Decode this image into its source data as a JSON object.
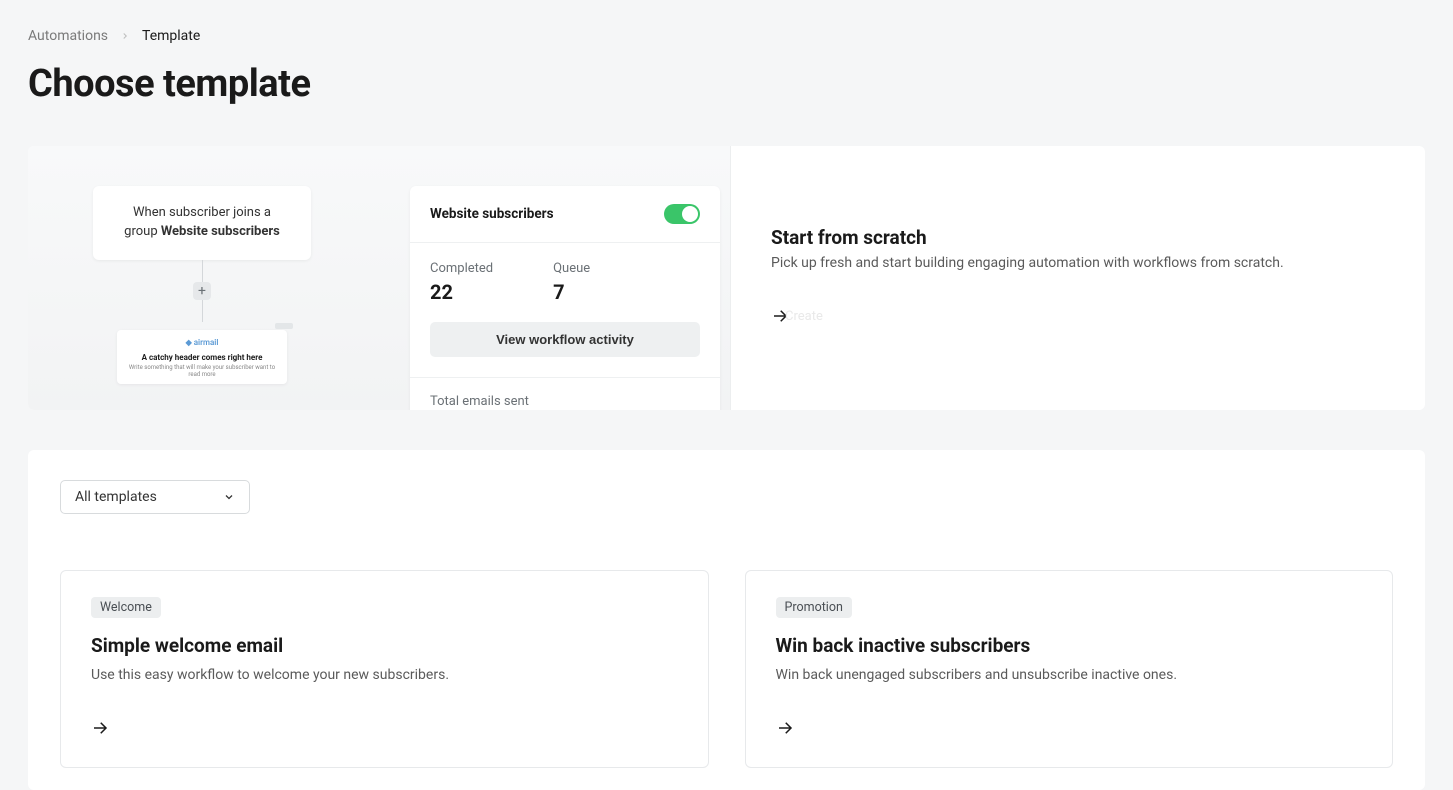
{
  "breadcrumb": {
    "root": "Automations",
    "current": "Template"
  },
  "page_title": "Choose template",
  "hero": {
    "illustration": {
      "node_prefix": "When subscriber joins a group ",
      "node_bold": "Website subscribers",
      "email_preview_brand": "◆ airmail",
      "email_preview_headline": "A catchy header comes right here",
      "email_preview_sub": "Write something that will make your subscriber want to read more"
    },
    "stats": {
      "title": "Website subscribers",
      "toggle_on": true,
      "completed_label": "Completed",
      "completed_value": "22",
      "queue_label": "Queue",
      "queue_value": "7",
      "view_button": "View workflow activity",
      "total_label": "Total emails sent"
    },
    "scratch": {
      "title": "Start from scratch",
      "description": "Pick up fresh and start building engaging automation with workflows from scratch.",
      "cta": "Create"
    }
  },
  "templates_section": {
    "filter_selected": "All templates",
    "cards": [
      {
        "tag": "Welcome",
        "title": "Simple welcome email",
        "description": "Use this easy workflow to welcome your new subscribers."
      },
      {
        "tag": "Promotion",
        "title": "Win back inactive subscribers",
        "description": "Win back unengaged subscribers and unsubscribe inactive ones."
      }
    ]
  }
}
